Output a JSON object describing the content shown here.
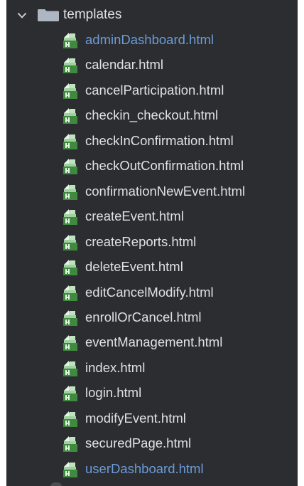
{
  "project_tree": {
    "folder": {
      "name": "templates",
      "expanded": true,
      "icon": "folder-icon",
      "chevron": "chevron-down-icon"
    },
    "file_icon": "html-file-icon",
    "files": [
      {
        "name": "adminDashboard.html",
        "modified": true
      },
      {
        "name": "calendar.html",
        "modified": false
      },
      {
        "name": "cancelParticipation.html",
        "modified": false
      },
      {
        "name": "checkin_checkout.html",
        "modified": false
      },
      {
        "name": "checkInConfirmation.html",
        "modified": false
      },
      {
        "name": "checkOutConfirmation.html",
        "modified": false
      },
      {
        "name": "confirmationNewEvent.html",
        "modified": false
      },
      {
        "name": "createEvent.html",
        "modified": false
      },
      {
        "name": "createReports.html",
        "modified": false
      },
      {
        "name": "deleteEvent.html",
        "modified": false
      },
      {
        "name": "editCancelModify.html",
        "modified": false
      },
      {
        "name": "enrollOrCancel.html",
        "modified": false
      },
      {
        "name": "eventManagement.html",
        "modified": false
      },
      {
        "name": "index.html",
        "modified": false
      },
      {
        "name": "login.html",
        "modified": false
      },
      {
        "name": "modifyEvent.html",
        "modified": false
      },
      {
        "name": "securedPage.html",
        "modified": false
      },
      {
        "name": "userDashboard.html",
        "modified": true
      }
    ],
    "colors": {
      "background": "#2b2d30",
      "text": "#dfe1e5",
      "modified_text": "#6c9bd8",
      "folder": "#aeb6c1",
      "html_icon_green": "#3f8a3e",
      "html_icon_light": "#bfe3bf"
    }
  }
}
